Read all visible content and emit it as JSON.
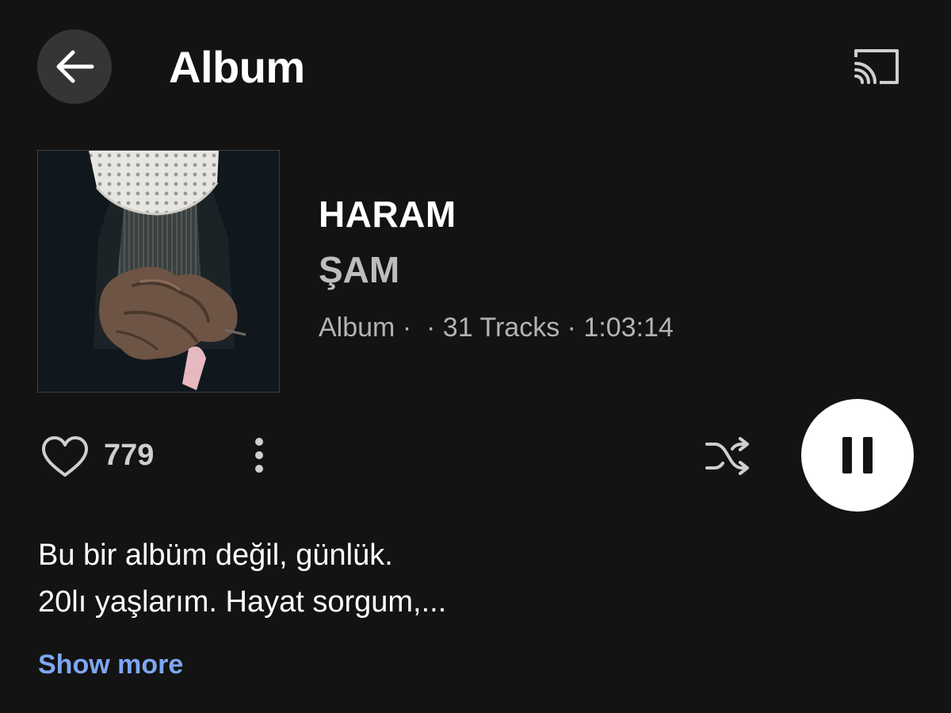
{
  "header": {
    "title": "Album",
    "back_icon": "arrow-left-icon",
    "cast_icon": "cast-icon"
  },
  "album": {
    "title": "HARAM",
    "artist": "ŞAM",
    "meta": "Album ·  · 31 Tracks · 1:03:14",
    "cover_description_icon": "album-cover-art"
  },
  "actions": {
    "like_count": "779",
    "like_icon": "heart-outline-icon",
    "more_icon": "more-vertical-icon",
    "shuffle_icon": "shuffle-icon",
    "play_state_icon": "pause-icon"
  },
  "description": {
    "line1": "Bu bir albüm değil, günlük.",
    "line2": "20lı yaşlarım. Hayat sorgum,...",
    "show_more": "Show more"
  },
  "colors": {
    "background": "#131313",
    "link": "#7ea7f2",
    "secondary_text": "#b3b3b3"
  }
}
